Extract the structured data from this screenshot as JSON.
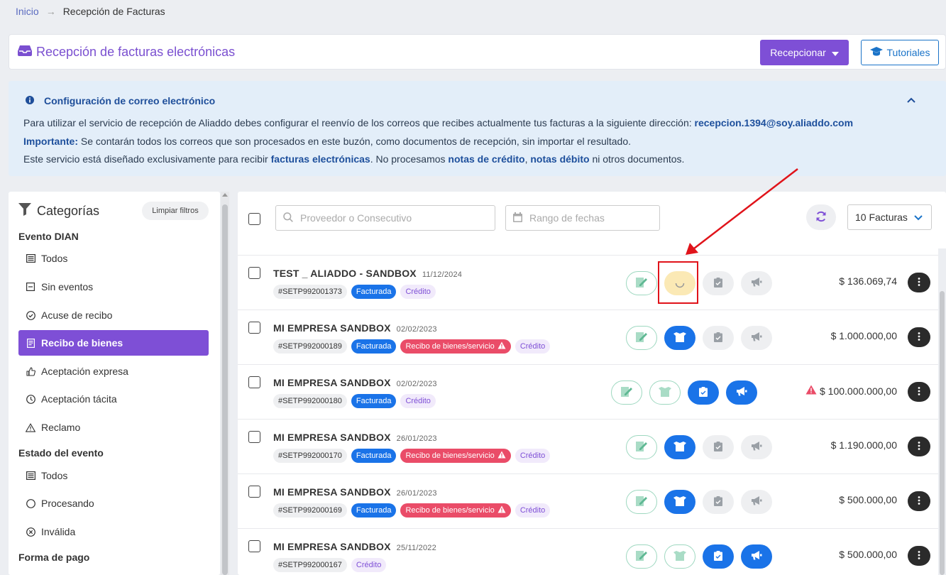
{
  "breadcrumb": {
    "home": "Inicio",
    "separator": "→",
    "current": "Recepción de Facturas"
  },
  "header": {
    "title": "Recepción de facturas electrónicas",
    "receive_button": "Recepcionar",
    "tutorials_button": "Tutoriales"
  },
  "info": {
    "title": "Configuración de correo electrónico",
    "line1_text": "Para utilizar el servicio de recepción de Aliaddo debes configurar el reenvío de los correos que recibes actualmente tus facturas a la siguiente dirección: ",
    "line1_email": "recepcion.1394@soy.aliaddo.com",
    "line2_bold": "Importante:",
    "line2_text": " Se contarán todos los correos que son procesados en este buzón, como documentos de recepción, sin importar el resultado.",
    "line3_a": "Este servicio está diseñado exclusivamente para recibir ",
    "line3_b": "facturas electrónicas",
    "line3_c": ". No procesamos ",
    "line3_d": "notas de crédito",
    "line3_e": ", ",
    "line3_f": "notas débito",
    "line3_g": " ni otros documentos."
  },
  "sidebar": {
    "title": "Categorías",
    "clear_filters": "Limpiar filtros",
    "section_event": "Evento DIAN",
    "event_items": [
      {
        "label": "Todos",
        "icon": "list-icon"
      },
      {
        "label": "Sin eventos",
        "icon": "minus-square-icon"
      },
      {
        "label": "Acuse de recibo",
        "icon": "check-circle-icon"
      },
      {
        "label": "Recibo de bienes",
        "icon": "receipt-icon"
      },
      {
        "label": "Aceptación expresa",
        "icon": "thumbs-up-icon"
      },
      {
        "label": "Aceptación tácita",
        "icon": "clock-icon"
      },
      {
        "label": "Reclamo",
        "icon": "warning-icon"
      }
    ],
    "active_item": "Recibo de bienes",
    "section_status": "Estado del evento",
    "status_items": [
      {
        "label": "Todos",
        "icon": "list-icon"
      },
      {
        "label": "Procesando",
        "icon": "circle-icon"
      },
      {
        "label": "Inválida",
        "icon": "x-circle-icon"
      }
    ],
    "section_payment": "Forma de pago"
  },
  "toolbar": {
    "search_placeholder": "Proveedor o Consecutivo",
    "date_placeholder": "Rango de fechas",
    "per_page": "10 Facturas"
  },
  "invoices": [
    {
      "name": "TEST _ ALIADDO - SANDBOX",
      "date": "11/12/2024",
      "id": "#SETP992001373",
      "tags": [
        "Facturada",
        "Crédito"
      ],
      "amount": "$ 136.069,74",
      "warning": false
    },
    {
      "name": "MI EMPRESA SANDBOX",
      "date": "02/02/2023",
      "id": "#SETP992000189",
      "tags": [
        "Facturada",
        "Recibo de bienes/servicio",
        "Crédito"
      ],
      "amount": "$ 1.000.000,00",
      "warning": false
    },
    {
      "name": "MI EMPRESA SANDBOX",
      "date": "02/02/2023",
      "id": "#SETP992000180",
      "tags": [
        "Facturada",
        "Crédito"
      ],
      "amount": "$ 100.000.000,00",
      "warning": true
    },
    {
      "name": "MI EMPRESA SANDBOX",
      "date": "26/01/2023",
      "id": "#SETP992000170",
      "tags": [
        "Facturada",
        "Recibo de bienes/servicio",
        "Crédito"
      ],
      "amount": "$ 1.190.000,00",
      "warning": false
    },
    {
      "name": "MI EMPRESA SANDBOX",
      "date": "26/01/2023",
      "id": "#SETP992000169",
      "tags": [
        "Facturada",
        "Recibo de bienes/servicio",
        "Crédito"
      ],
      "amount": "$ 500.000,00",
      "warning": false
    },
    {
      "name": "MI EMPRESA SANDBOX",
      "date": "25/11/2022",
      "id": "#SETP992000167",
      "tags": [
        "Crédito"
      ],
      "amount": "$ 500.000,00",
      "warning": false
    }
  ],
  "colors": {
    "accent": "#7e4fd6",
    "primary_blue": "#1a73e8",
    "danger": "#ea4c68",
    "annotation_red": "#e0131a"
  }
}
